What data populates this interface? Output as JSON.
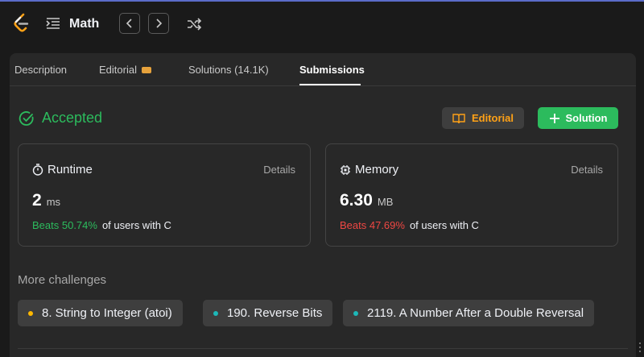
{
  "header": {
    "app_title": "Math",
    "icons": [
      "leetcode-logo",
      "problem-list-icon",
      "prev-problem-icon",
      "next-problem-icon",
      "shuffle-icon"
    ]
  },
  "tabs": [
    {
      "label": "Description",
      "active": false
    },
    {
      "label": "Editorial",
      "active": false
    },
    {
      "label": "Solutions (14.1K)",
      "active": false
    },
    {
      "label": "Submissions",
      "active": true
    }
  ],
  "result": {
    "status": "Accepted",
    "status_color": "#2cbb5d",
    "editorial_button": "Editorial",
    "solution_button": "Solution"
  },
  "runtime": {
    "title": "Runtime",
    "details": "Details",
    "value": "2",
    "unit": "ms",
    "beats": "Beats 50.74%",
    "suffix": "of users with C",
    "beats_color": "#2cbb5d"
  },
  "memory": {
    "title": "Memory",
    "details": "Details",
    "value": "6.30",
    "unit": "MB",
    "beats": "Beats 47.69%",
    "suffix": "of users with C",
    "beats_color": "#ef4743"
  },
  "more": {
    "title": "More challenges",
    "challenges": [
      {
        "label": "8. String to Integer (atoi)",
        "dot_color": "#ffb800"
      },
      {
        "label": "190. Reverse Bits",
        "dot_color": "#1cb8b8"
      },
      {
        "label": "2119. A Number After a Double Reversal",
        "dot_color": "#1cb8b8"
      }
    ]
  }
}
